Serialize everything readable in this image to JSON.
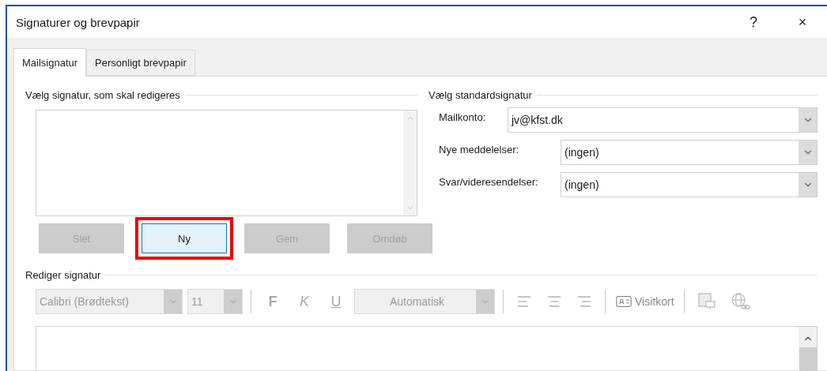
{
  "window": {
    "title": "Signaturer og brevpapir",
    "help_button": "?",
    "close_button": "×"
  },
  "tabs": [
    {
      "label": "Mailsignatur",
      "selected": true
    },
    {
      "label": "Personligt brevpapir",
      "selected": false
    }
  ],
  "select_signature": {
    "heading": "Vælg signatur, som skal redigeres",
    "buttons": [
      {
        "label": "Slet",
        "disabled": true,
        "highlighted": false
      },
      {
        "label": "Ny",
        "disabled": false,
        "highlighted": true
      },
      {
        "label": "Gem",
        "disabled": true,
        "highlighted": false
      },
      {
        "label": "Omdøb",
        "disabled": true,
        "highlighted": false
      }
    ]
  },
  "default_signature": {
    "heading": "Vælg standardsignatur",
    "fields": [
      {
        "label": "Mailkonto:",
        "value": "jv@kfst.dk"
      },
      {
        "label": "Nye meddelelser:",
        "value": "(ingen)"
      },
      {
        "label": "Svar/videresendelser:",
        "value": "(ingen)"
      }
    ]
  },
  "edit_signature": {
    "heading": "Rediger signatur",
    "toolbar": [
      {
        "kind": "combo",
        "value": "Calibri (Brødtekst)",
        "disabled": true
      },
      {
        "kind": "combo",
        "value": "11",
        "disabled": true
      },
      {
        "kind": "separator"
      },
      {
        "kind": "bold",
        "label": "F",
        "disabled": true
      },
      {
        "kind": "italic",
        "label": "K",
        "disabled": true
      },
      {
        "kind": "underline",
        "label": "U",
        "disabled": true
      },
      {
        "kind": "combo",
        "value": "Automatisk",
        "disabled": true
      },
      {
        "kind": "separator"
      },
      {
        "kind": "alignleft",
        "disabled": true
      },
      {
        "kind": "aligncenter",
        "disabled": true
      },
      {
        "kind": "alignright",
        "disabled": true
      },
      {
        "kind": "separator"
      },
      {
        "kind": "cardbutton",
        "label": "Visitkort",
        "disabled": true
      },
      {
        "kind": "separator"
      },
      {
        "kind": "imagebutton",
        "disabled": true
      },
      {
        "kind": "linkbutton",
        "disabled": true
      }
    ]
  }
}
